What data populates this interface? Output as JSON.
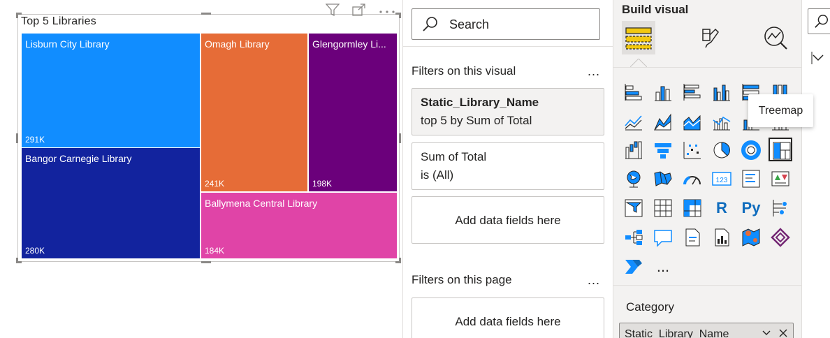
{
  "treemap": {
    "title": "Top 5 Libraries",
    "chart_data": {
      "type": "treemap",
      "title": "Top 5 Libraries",
      "items": [
        {
          "name": "Lisburn City Library",
          "label": "291K",
          "value": 291000,
          "color": "#118dff"
        },
        {
          "name": "Bangor Carnegie Library",
          "label": "280K",
          "value": 280000,
          "color": "#12239e"
        },
        {
          "name": "Omagh Library",
          "label": "241K",
          "value": 241000,
          "color": "#e66c37"
        },
        {
          "name": "Glengormley Li...",
          "label": "198K",
          "value": 198000,
          "color": "#6b007b"
        },
        {
          "name": "Ballymena Central Library",
          "label": "184K",
          "value": 184000,
          "color": "#e044a7"
        }
      ]
    }
  },
  "filters": {
    "search_placeholder": "Search",
    "visual_section_label": "Filters on this visual",
    "page_section_label": "Filters on this page",
    "more_label": "...",
    "cards": [
      {
        "title": "Static_Library_Name",
        "subtitle": "top 5 by Sum of Total"
      },
      {
        "title": "Sum of Total",
        "subtitle": "is (All)"
      }
    ],
    "add_fields_label": "Add data fields here"
  },
  "build": {
    "title": "Build visual",
    "tooltip": "Treemap",
    "more_visuals": "...",
    "r_label": "R",
    "py_label": "Py",
    "card_label": "123",
    "category_label": "Category",
    "category_field": "Static_Library_Name"
  },
  "colors": {
    "accent": "#0f6cbd",
    "yellow": "#f2c811"
  }
}
